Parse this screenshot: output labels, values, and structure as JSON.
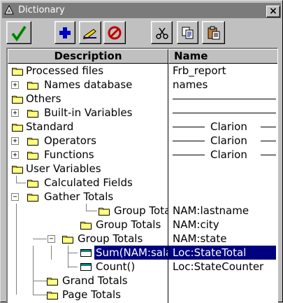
{
  "window": {
    "title": "Dictionary",
    "close_label": "×"
  },
  "toolbar": {
    "buttons": [
      {
        "name": "checkmark-icon",
        "color": "#00a000"
      },
      {
        "name": "add-icon",
        "color": "#0000c0"
      },
      {
        "name": "edit-icon",
        "color": "#000080"
      },
      {
        "name": "delete-icon",
        "color": "#c00000"
      },
      {
        "name": "cut-icon",
        "color": "#000000"
      },
      {
        "name": "copy-icon",
        "color": "#000000"
      },
      {
        "name": "paste-icon",
        "color": "#000000"
      }
    ]
  },
  "columns": {
    "description": "Description",
    "name": "Name"
  },
  "tree": [
    {
      "label": "Processed files",
      "name": "Frb_report",
      "expander": "",
      "icon": "folder-icon"
    },
    {
      "label": "Names database",
      "name": "names",
      "expander": "+",
      "icon": "folder-icon"
    },
    {
      "label": "Others",
      "name": "",
      "expander": "",
      "icon": "folder-icon"
    },
    {
      "label": "Built-in Variables",
      "name": "",
      "expander": "+",
      "icon": "folder-icon"
    },
    {
      "label": "Standard",
      "name": "Clarion",
      "expander": "",
      "icon": "folder-icon"
    },
    {
      "label": "Operators",
      "name": "Clarion",
      "expander": "+",
      "icon": "folder-icon"
    },
    {
      "label": "Functions",
      "name": "Clarion",
      "expander": "+",
      "icon": "folder-icon"
    },
    {
      "label": "User Variables",
      "name": "",
      "expander": "",
      "icon": "folder-icon"
    },
    {
      "label": "Calculated Fields",
      "name": "",
      "expander": "",
      "icon": "folder-icon"
    },
    {
      "label": "Gather Totals",
      "name": "",
      "expander": "−",
      "icon": "folder-icon"
    },
    {
      "label": "Group Totals",
      "name": "NAM:lastname",
      "expander": "",
      "icon": "folder-icon"
    },
    {
      "label": "Group Totals",
      "name": "NAM:city",
      "expander": "",
      "icon": "folder-icon"
    },
    {
      "label": "Group Totals",
      "name": "NAM:state",
      "expander": "−",
      "icon": "folder-icon"
    },
    {
      "label": "Sum(NAM:salary)",
      "name": "Loc:StateTotal",
      "expander": "",
      "icon": "field-icon",
      "selected": true
    },
    {
      "label": "Count()",
      "name": "Loc:StateCounter",
      "expander": "",
      "icon": "field-icon"
    },
    {
      "label": "Grand Totals",
      "name": "",
      "expander": "",
      "icon": "folder-icon"
    },
    {
      "label": "Page Totals",
      "name": "",
      "expander": "",
      "icon": "folder-icon"
    }
  ]
}
